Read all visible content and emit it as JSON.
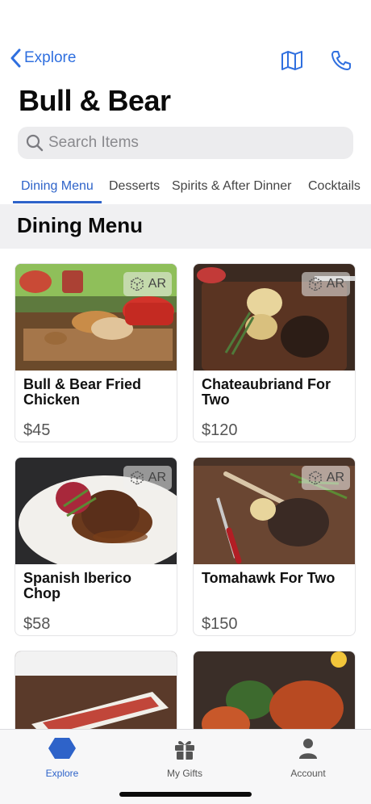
{
  "nav": {
    "back_label": "Explore",
    "map_icon": "map-icon",
    "phone_icon": "phone-icon"
  },
  "restaurant": {
    "name": "Bull & Bear"
  },
  "search": {
    "placeholder": "Search Items",
    "value": ""
  },
  "tabs": [
    {
      "label": "Dining Menu",
      "active": true
    },
    {
      "label": "Desserts",
      "active": false
    },
    {
      "label": "Spirits & After Dinner",
      "active": false
    },
    {
      "label": "Cocktails",
      "active": false
    }
  ],
  "section": {
    "title": "Dining Menu"
  },
  "items": [
    {
      "name": "Bull & Bear Fried Chicken",
      "price": "$45",
      "ar": "AR"
    },
    {
      "name": "Chateaubriand For Two",
      "price": "$120",
      "ar": "AR"
    },
    {
      "name": "Spanish Iberico Chop",
      "price": "$58",
      "ar": "AR"
    },
    {
      "name": "Tomahawk For Two",
      "price": "$150",
      "ar": "AR"
    }
  ],
  "tab_bar": [
    {
      "label": "Explore",
      "icon": "explore-hexagon-icon",
      "active": true
    },
    {
      "label": "My Gifts",
      "icon": "gift-icon",
      "active": false
    },
    {
      "label": "Account",
      "icon": "person-icon",
      "active": false
    }
  ],
  "colors": {
    "accent": "#2e63c9",
    "link": "#2f6fdf",
    "section_bg": "#f0f0f2"
  }
}
